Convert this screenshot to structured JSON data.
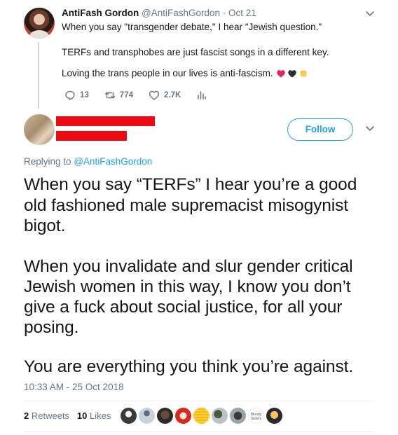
{
  "parent_tweet": {
    "name": "AntiFash Gordon",
    "handle": "@AntiFashGordon",
    "date": "· Oct 21",
    "line1": "When you say \"transgender debate,\" I hear \"Jewish question.\"",
    "line2": "TERFs and transphobes are just fascist songs in a different key.",
    "line3": "Loving the trans people in our lives is anti-fascism.",
    "reply_count": "13",
    "retweet_count": "774",
    "like_count": "2.7K",
    "heart_colors": [
      "#e0245e",
      "#14171a",
      "#ffcc4d"
    ]
  },
  "main_tweet": {
    "follow_label": "Follow",
    "replying_prefix": "Replying to",
    "replying_handle": "@AntiFashGordon",
    "lines": [
      "When you say “TERFs” I hear you’re a good",
      "old fashioned male supremacist misogynist",
      "bigot.",
      "When you invalidate and slur gender critical",
      "Jewish women in this way, I know you don’t",
      "give a fuck about social justice, for all your",
      "posing.",
      "You are everything you think you’re against."
    ],
    "timestamp": "10:33 AM - 25 Oct 2018",
    "retweets_count": "2",
    "retweets_label": "Retweets",
    "likes_count": "10",
    "likes_label": "Likes",
    "liker_badge_text": "Bloody Sisters"
  },
  "colors": {
    "accent": "#1da1f2",
    "muted": "#657786",
    "text": "#14171a",
    "redaction": "#ee0a15"
  }
}
